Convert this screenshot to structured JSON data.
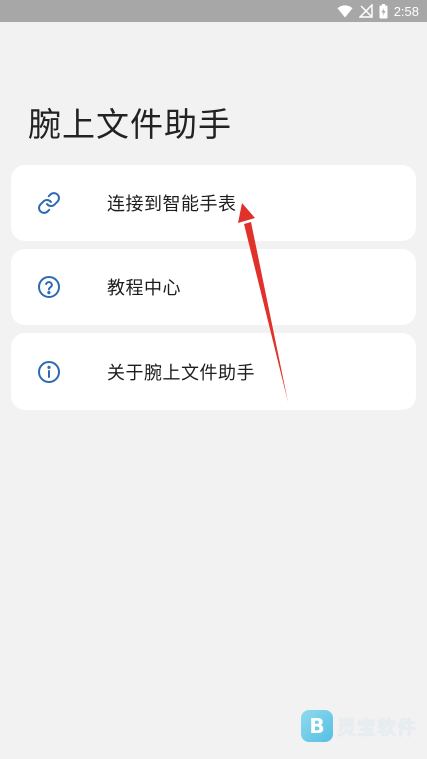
{
  "status_bar": {
    "time": "2:58",
    "icons": [
      "wifi-icon",
      "signal-icon",
      "battery-icon"
    ]
  },
  "page": {
    "title": "腕上文件助手"
  },
  "menu": {
    "items": [
      {
        "icon": "link-icon",
        "label": "连接到智能手表"
      },
      {
        "icon": "help-circle-icon",
        "label": "教程中心"
      },
      {
        "icon": "info-circle-icon",
        "label": "关于腕上文件助手"
      }
    ]
  },
  "watermark": {
    "logo_letter": "B",
    "text": "灵宝软件"
  },
  "colors": {
    "background": "#f2f2f2",
    "status_bar": "#a7a7a7",
    "card": "#ffffff",
    "icon_blue": "#2e6ab3",
    "annotation_red": "#e0322b"
  }
}
